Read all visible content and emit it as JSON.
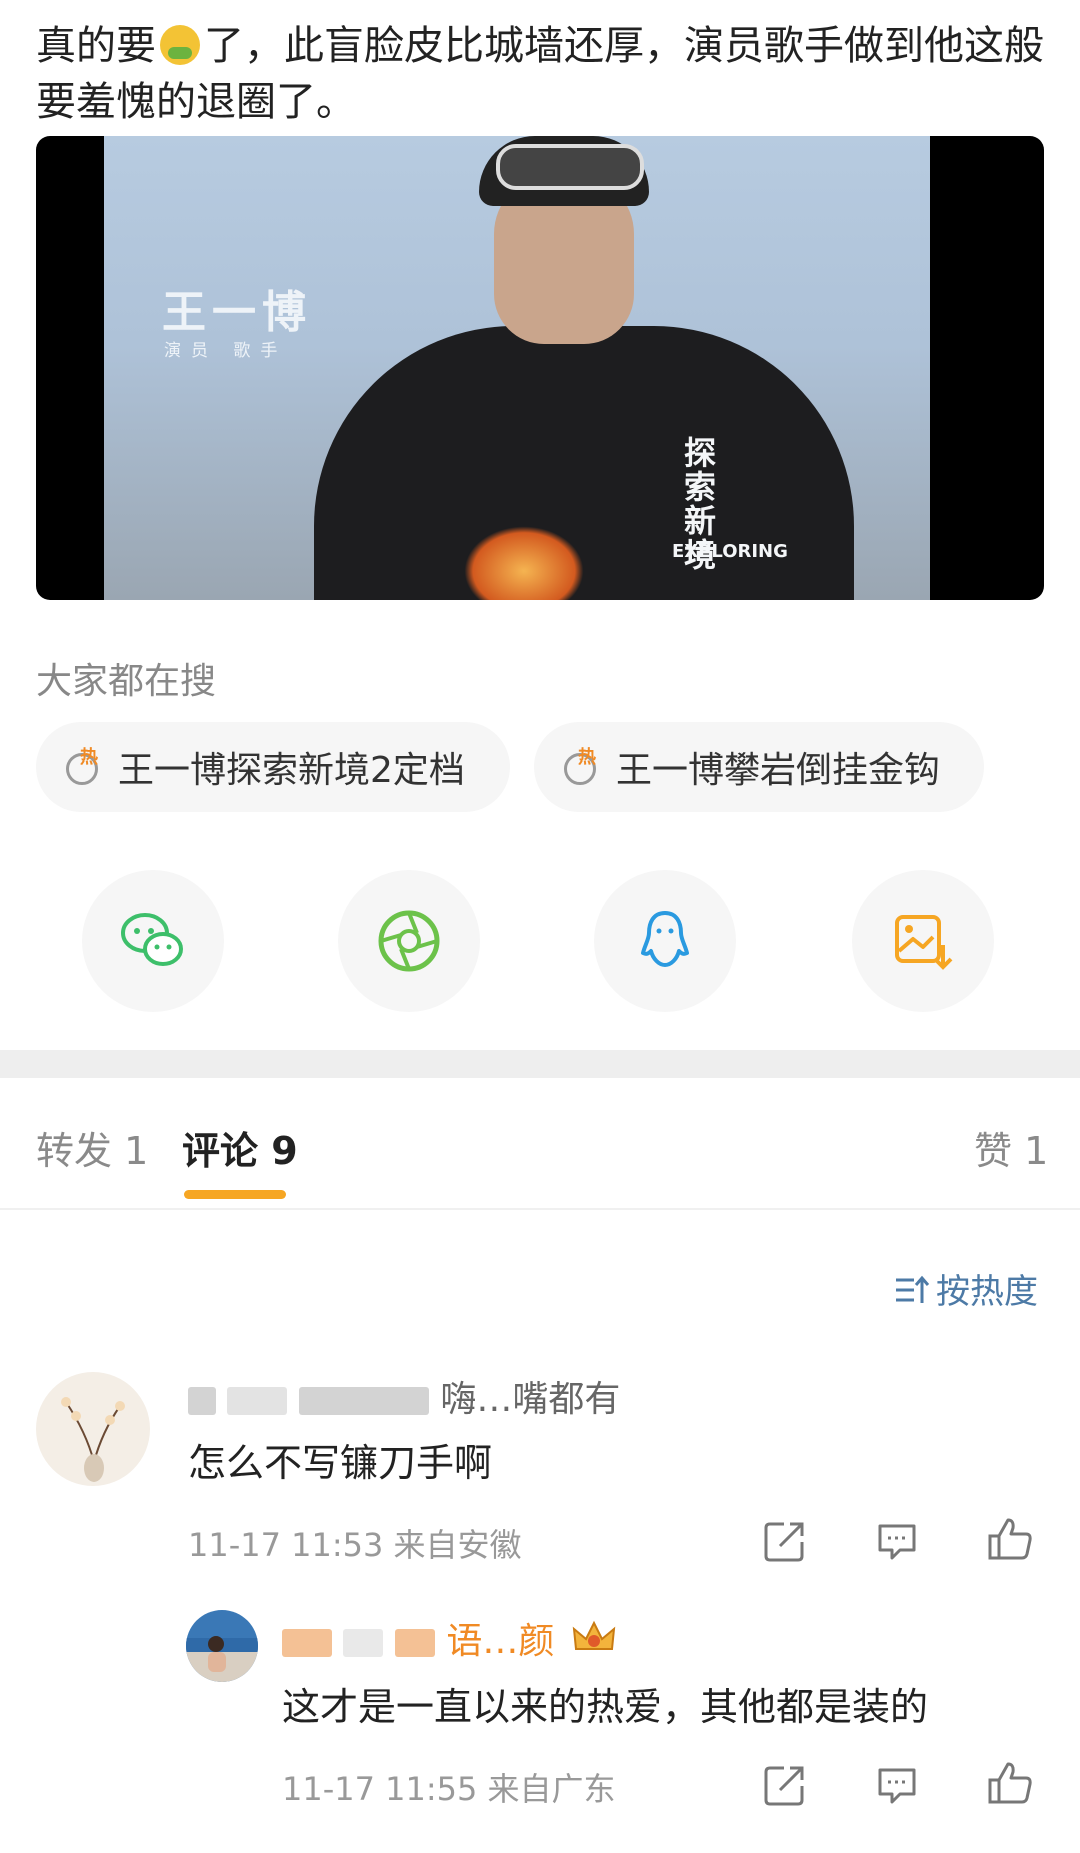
{
  "post": {
    "text_part1": "真的要",
    "text_part2": "了，此盲脸皮比城墙还厚，演员歌手做到他这般要羞愧的退圈了。",
    "emoji_icon": "nauseated-face-emoji"
  },
  "video": {
    "name_caption": "王一博",
    "role_caption": "演员 歌手",
    "show_title_cn": "探索新境",
    "show_title_en": "EXPLORING"
  },
  "trending": {
    "label": "大家都在搜",
    "chips": [
      {
        "text": "王一博探索新境2定档",
        "icon": "hot-search-icon"
      },
      {
        "text": "王一博攀岩倒挂金钩",
        "icon": "hot-search-icon"
      }
    ]
  },
  "share": {
    "items": [
      {
        "icon": "wechat-icon",
        "color": "#3dbf6a"
      },
      {
        "icon": "moments-icon",
        "color": "#6cc24a"
      },
      {
        "icon": "qq-icon",
        "color": "#2a9ae0"
      },
      {
        "icon": "save-image-icon",
        "color": "#f6a623"
      }
    ]
  },
  "tabs": {
    "repost": "转发 1",
    "comment": "评论 9",
    "like": "赞 1",
    "accent": "#f6a623"
  },
  "sort_label": "按热度",
  "comments": [
    {
      "username": "嗨…嘴都有",
      "text": "怎么不写镰刀手啊",
      "time": "11-17 11:53",
      "location": "来自安徽"
    },
    {
      "username": "语…颜",
      "text": "这才是一直以来的热爱，其他都是装的",
      "time": "11-17 11:55",
      "location": "来自广东",
      "badge_icon": "crown-badge-icon"
    }
  ]
}
